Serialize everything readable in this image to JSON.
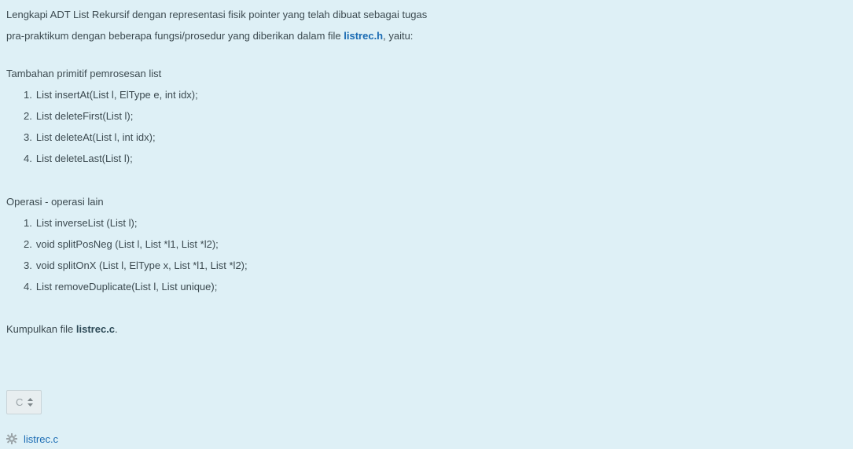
{
  "intro": {
    "line1": "Lengkapi ADT List Rekursif dengan representasi fisik pointer yang telah dibuat sebagai tugas",
    "line2_prefix": "pra-praktikum dengan beberapa fungsi/prosedur yang diberikan dalam file ",
    "line2_link": "listrec.h",
    "line2_suffix": ", yaitu:"
  },
  "section1": {
    "heading": "Tambahan primitif pemrosesan list",
    "items": [
      {
        "num": "1.",
        "text": "List insertAt(List l, ElType e, int idx);"
      },
      {
        "num": "2.",
        "text": "List deleteFirst(List l);"
      },
      {
        "num": "3.",
        "text": "List deleteAt(List l, int idx);"
      },
      {
        "num": "4.",
        "text": "List deleteLast(List l);"
      }
    ]
  },
  "section2": {
    "heading": "Operasi - operasi lain",
    "items": [
      {
        "num": "1.",
        "text": "List inverseList (List l);"
      },
      {
        "num": "2.",
        "text": "void splitPosNeg (List l, List *l1, List *l2);"
      },
      {
        "num": "3.",
        "text": "void splitOnX (List l, ElType x, List *l1, List *l2);"
      },
      {
        "num": "4.",
        "text": "List removeDuplicate(List l, List unique);"
      }
    ]
  },
  "submit": {
    "prefix": "Kumpulkan file ",
    "filename": "listrec.c",
    "suffix": "."
  },
  "language_select": {
    "value": "C"
  },
  "file_entry": {
    "icon": "gear-icon",
    "name": "listrec.c"
  },
  "colors": {
    "background": "#def0f6",
    "text": "#3c4a50",
    "link": "#1a6bb3"
  }
}
